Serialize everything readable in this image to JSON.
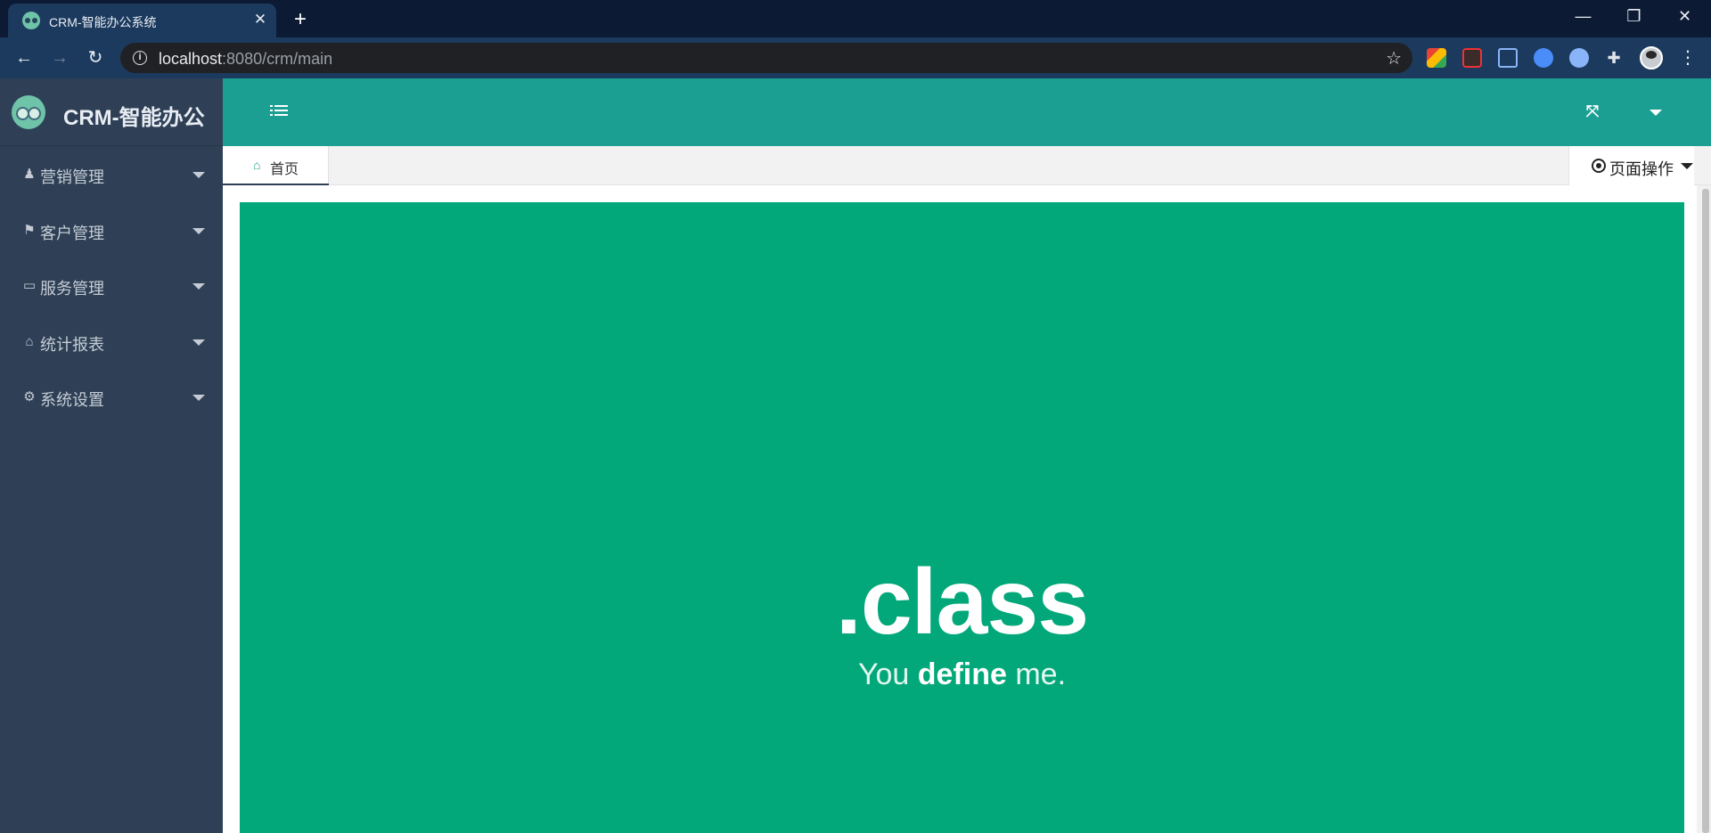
{
  "browser": {
    "tab_title": "CRM-智能办公系统",
    "url_host": "localhost",
    "url_rest": ":8080/crm/main"
  },
  "app": {
    "brand": "CRM-智能办公",
    "menu": [
      {
        "label": "营销管理",
        "icon": "person-icon"
      },
      {
        "label": "客户管理",
        "icon": "flag-icon"
      },
      {
        "label": "服务管理",
        "icon": "monitor-icon"
      },
      {
        "label": "统计报表",
        "icon": "home-icon"
      },
      {
        "label": "系统设置",
        "icon": "gears-icon"
      }
    ],
    "tabs": {
      "home": "首页",
      "page_ops": "页面操作"
    },
    "hero": {
      "title": ".class",
      "sub_pre": "You",
      "sub_bold": "define",
      "sub_post": "me."
    },
    "colors": {
      "sidebar": "#2f4056",
      "header": "#1c9f93",
      "hero": "#02a879"
    }
  }
}
